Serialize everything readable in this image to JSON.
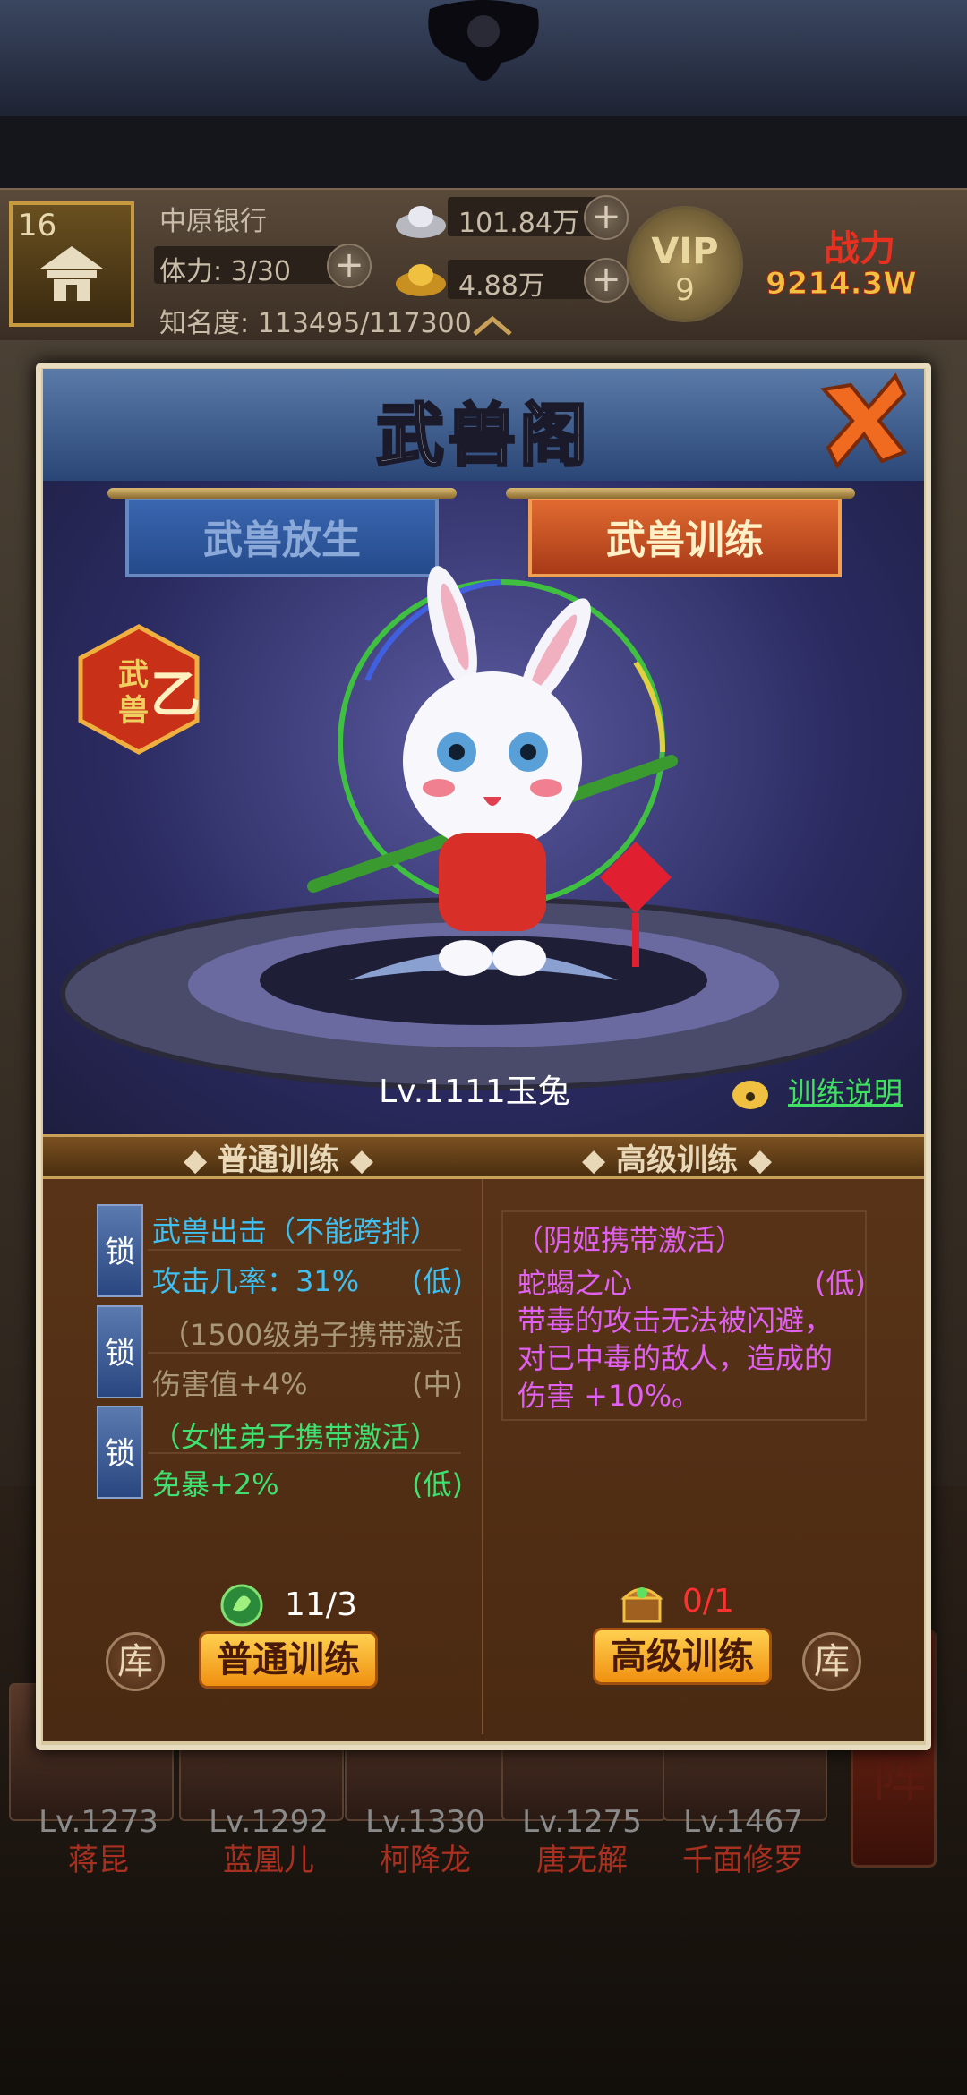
{
  "status": {
    "level": "16",
    "name": "中原银行",
    "stamina_label": "体力: 3/30",
    "fame_label": "知名度: 113495/117300",
    "silver": "101.84万",
    "gold": "4.88万",
    "vip_label": "VIP",
    "vip_level": "9",
    "power_label": "战力",
    "power_value": "9214.3W"
  },
  "panel": {
    "title": "武兽阁",
    "tabs": [
      "武兽放生",
      "武兽训练"
    ],
    "grade_badge": "武兽乙",
    "pet_name": "Lv.1111玉兔",
    "train_info": "训练说明"
  },
  "sections": {
    "normal_title": "◆ 普通训练 ◆",
    "advanced_title": "◆ 高级训练 ◆"
  },
  "normal_skills": [
    {
      "lock": "锁",
      "line1": "武兽出击（不能跨排）",
      "line2": "攻击几率：31%",
      "grade": "(低)"
    },
    {
      "lock": "锁",
      "line1": "（1500级弟子携带激活",
      "line2": "伤害值+4%",
      "grade": "(中)"
    },
    {
      "lock": "锁",
      "line1": "（女性弟子携带激活）",
      "line2": "免暴+2%",
      "grade": "(低)"
    }
  ],
  "advanced_skill": {
    "activation": "（阴姬携带激活）",
    "name": "蛇蝎之心",
    "grade": "(低)",
    "desc1": "带毒的攻击无法被闪避，",
    "desc2": "对已中毒的敌人，造成的",
    "desc3": "伤害 +10%。"
  },
  "actions": {
    "normal_count": "11/3",
    "normal_button": "普通训练",
    "advanced_count": "0/1",
    "advanced_button": "高级训练",
    "storage": "库"
  },
  "heroes": [
    {
      "lv": "Lv.1273",
      "name": "蒋昆"
    },
    {
      "lv": "Lv.1292",
      "name": "蓝凰儿"
    },
    {
      "lv": "Lv.1330",
      "name": "柯降龙"
    },
    {
      "lv": "Lv.1275",
      "name": "唐无解"
    },
    {
      "lv": "Lv.1467",
      "name": "千面修罗"
    }
  ],
  "side_button": "布阵",
  "colors": {
    "panel_blue": "#2a4676",
    "tab_active": "#e06a30",
    "cyan_text": "#40c0f0",
    "green_text": "#40e070",
    "purple_text": "#e060f0",
    "button_yellow": "#ffd050"
  }
}
